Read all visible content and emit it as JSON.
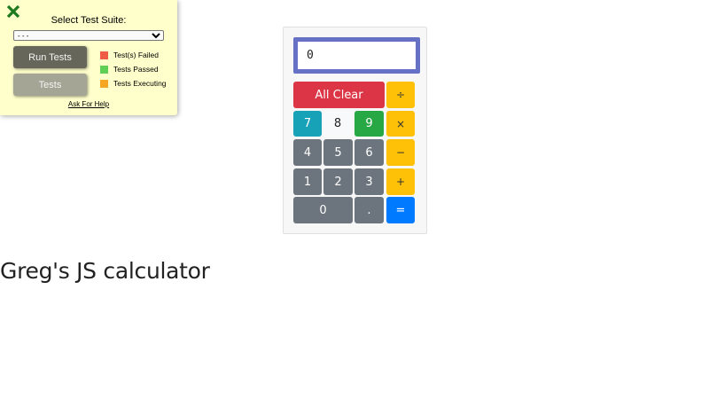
{
  "test_panel": {
    "close_icon": "close-x-icon",
    "suite_label": "Select Test Suite:",
    "suite_select": {
      "selected": "- - -",
      "options": [
        "- - -"
      ]
    },
    "run_tests_label": "Run Tests",
    "tests_label": "Tests",
    "legend": [
      {
        "label": "Test(s) Failed",
        "color": "#ef5b45"
      },
      {
        "label": "Tests Passed",
        "color": "#5fcf56"
      },
      {
        "label": "Tests Executing",
        "color": "#f5a623"
      }
    ],
    "help_label": "Ask For Help",
    "close_color": "#1e7a1e"
  },
  "calculator": {
    "display": "0",
    "keys": {
      "clear": "All Clear",
      "divide": "÷",
      "multiply": "×",
      "subtract": "−",
      "add": "+",
      "equals": "=",
      "decimal": ".",
      "seven": "7",
      "eight": "8",
      "nine": "9",
      "four": "4",
      "five": "5",
      "six": "6",
      "one": "1",
      "two": "2",
      "three": "3",
      "zero": "0"
    }
  },
  "page": {
    "title": "Greg's JS calculator"
  }
}
